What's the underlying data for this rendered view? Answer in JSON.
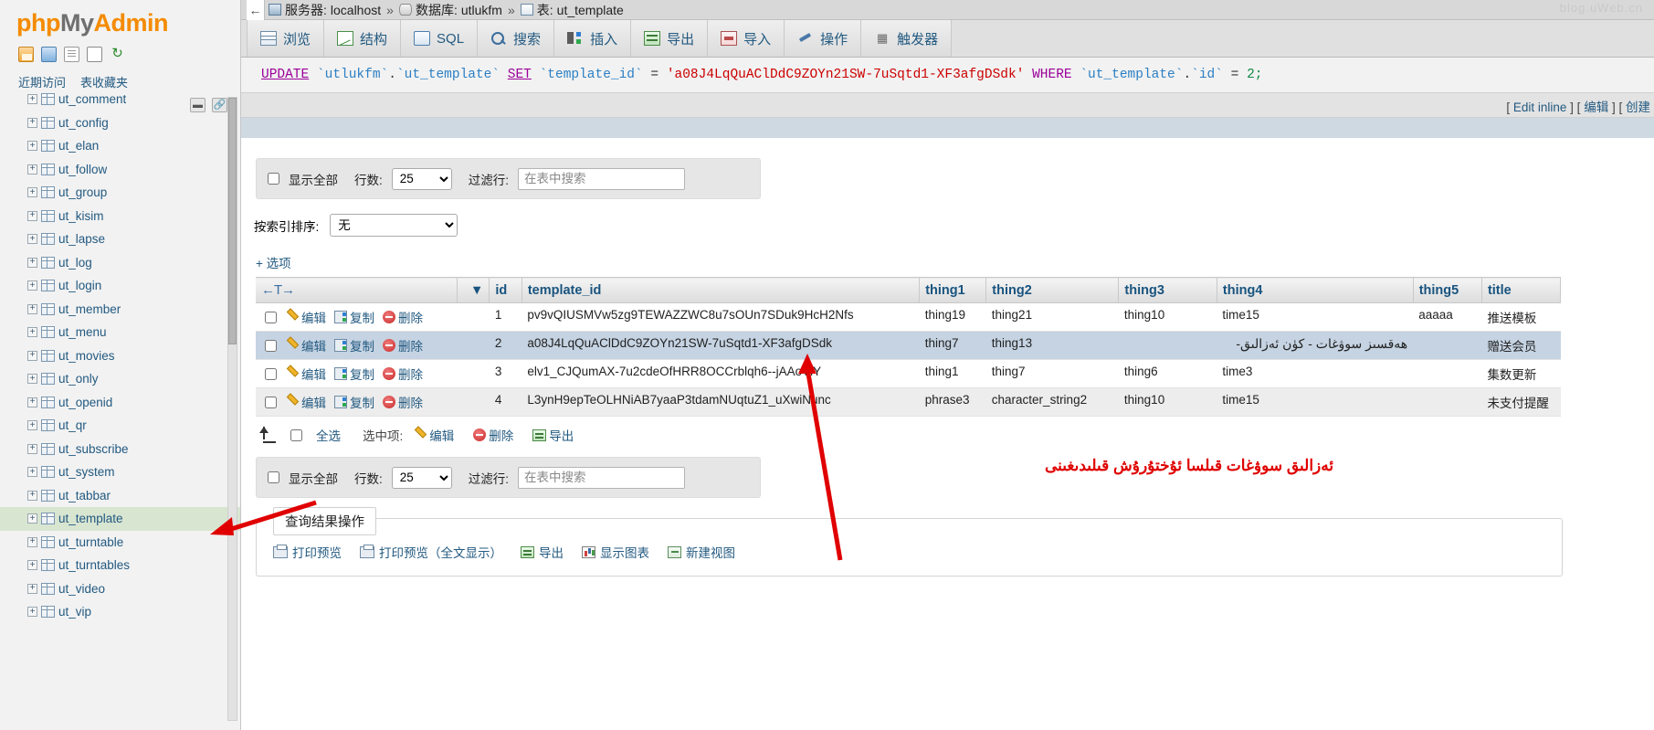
{
  "branding": {
    "logo_php": "php",
    "logo_my": "My",
    "logo_admin": "Admin"
  },
  "nav": {
    "icons": [
      "home-icon",
      "exit-icon",
      "docs-icon",
      "window-icon",
      "refresh-icon"
    ],
    "tabs": [
      {
        "label": "近期访问",
        "name": "recent-tab"
      },
      {
        "label": "表收藏夹",
        "name": "favorites-tab"
      }
    ],
    "collapse_buttons": [
      "collapse-icon",
      "link-icon"
    ],
    "tables": [
      {
        "label": "ut_comment",
        "selected": false
      },
      {
        "label": "ut_config",
        "selected": false
      },
      {
        "label": "ut_elan",
        "selected": false
      },
      {
        "label": "ut_follow",
        "selected": false
      },
      {
        "label": "ut_group",
        "selected": false
      },
      {
        "label": "ut_kisim",
        "selected": false
      },
      {
        "label": "ut_lapse",
        "selected": false
      },
      {
        "label": "ut_log",
        "selected": false
      },
      {
        "label": "ut_login",
        "selected": false
      },
      {
        "label": "ut_member",
        "selected": false
      },
      {
        "label": "ut_menu",
        "selected": false
      },
      {
        "label": "ut_movies",
        "selected": false
      },
      {
        "label": "ut_only",
        "selected": false
      },
      {
        "label": "ut_openid",
        "selected": false
      },
      {
        "label": "ut_qr",
        "selected": false
      },
      {
        "label": "ut_subscribe",
        "selected": false
      },
      {
        "label": "ut_system",
        "selected": false
      },
      {
        "label": "ut_tabbar",
        "selected": false
      },
      {
        "label": "ut_template",
        "selected": true
      },
      {
        "label": "ut_turntable",
        "selected": false
      },
      {
        "label": "ut_turntables",
        "selected": false
      },
      {
        "label": "ut_video",
        "selected": false
      },
      {
        "label": "ut_vip",
        "selected": false
      }
    ]
  },
  "breadcrumb": {
    "server_label": "服务器:",
    "server_value": "localhost",
    "db_label": "数据库:",
    "db_value": "utlukfm",
    "table_label": "表:",
    "table_value": "ut_template",
    "separator": "»",
    "watermark": "blog.uWeb.cn"
  },
  "tabs": [
    {
      "label": "浏览",
      "icon": "browse-icon"
    },
    {
      "label": "结构",
      "icon": "structure-icon"
    },
    {
      "label": "SQL",
      "icon": "sql-icon"
    },
    {
      "label": "搜索",
      "icon": "search-icon"
    },
    {
      "label": "插入",
      "icon": "insert-icon"
    },
    {
      "label": "导出",
      "icon": "export-icon"
    },
    {
      "label": "导入",
      "icon": "import-icon"
    },
    {
      "label": "操作",
      "icon": "operations-icon"
    },
    {
      "label": "触发器",
      "icon": "triggers-icon"
    }
  ],
  "sql": {
    "update": "UPDATE",
    "tick": "`",
    "db": "utlukfm",
    "dot": ".",
    "table": "ut_template",
    "set": "SET",
    "column": "template_id",
    "eq": "=",
    "quote": "'",
    "value": "a08J4LqQuAClDdC9ZOYn21SW-7uSqtd1-XF3afgDSdk",
    "where": "WHERE",
    "where_table": "ut_template",
    "where_col": "id",
    "where_eq": "=",
    "where_val": "2",
    "semicolon": ";"
  },
  "edit_links": {
    "open": "[",
    "edit_inline": "Edit inline",
    "mid1": "] [",
    "edit": "编辑",
    "mid2": "] [",
    "create": "创建",
    "full": "[ Edit inline ] [ 编辑 ] [ 创建"
  },
  "options_top": {
    "show_all_label": "显示全部",
    "rows_label": "行数:",
    "rows_value": "25",
    "filter_label": "过滤行:",
    "filter_placeholder": "在表中搜索",
    "filter_value": ""
  },
  "sort": {
    "label": "按索引排序:",
    "value": "无"
  },
  "options_link": "+ 选项",
  "table": {
    "nav_arrows": "←T→",
    "sort_caret": "▼",
    "columns": [
      "id",
      "template_id",
      "thing1",
      "thing2",
      "thing3",
      "thing4",
      "thing5",
      "title"
    ],
    "row_actions": {
      "edit": "编辑",
      "copy": "复制",
      "delete": "删除"
    },
    "rows": [
      {
        "id": "1",
        "template_id": "pv9vQIUSMVw5zg9TEWAZZWC8u7sOUn7SDuk9HcH2Nfs",
        "thing1": "thing19",
        "thing2": "thing21",
        "thing3": "thing10",
        "thing4": "time15",
        "thing5": "aaaaa",
        "title": "推送模板",
        "highlight": false,
        "wrap": false
      },
      {
        "id": "2",
        "template_id": "a08J4LqQuAClDdC9ZOYn21SW-7uSqtd1-XF3afgDSdk",
        "thing1": "thing7",
        "thing2": "thing13",
        "thing3": "",
        "thing4": "هەقسىز سوۋغات - كۈن ئەزالىق-",
        "thing5": "",
        "title": "赠送会员",
        "highlight": true,
        "wrap": true
      },
      {
        "id": "3",
        "template_id": "elv1_CJQumAX-7u2cdeOfHRR8OCCrblqh6--jAAoVlY",
        "thing1": "thing1",
        "thing2": "thing7",
        "thing3": "thing6",
        "thing4": "time3",
        "thing5": "",
        "title": "集数更新",
        "highlight": false,
        "wrap": true
      },
      {
        "id": "4",
        "template_id": "L3ynH9epTeOLHNiAB7yaaP3tdamNUqtuZ1_uXwiNunc",
        "thing1": "phrase3",
        "thing2": "character_string2",
        "thing3": "thing10",
        "thing4": "time15",
        "thing5": "",
        "title": "未支付提醒",
        "highlight": false,
        "wrap": false
      }
    ]
  },
  "bottom_actions": {
    "select_all": "全选",
    "with_selected": "选中项:",
    "edit": "编辑",
    "delete": "删除",
    "export": "导出"
  },
  "options_bottom": {
    "show_all_label": "显示全部",
    "rows_label": "行数:",
    "rows_value": "25",
    "filter_label": "过滤行:",
    "filter_placeholder": "在表中搜索",
    "filter_value": ""
  },
  "result_ops": {
    "legend": "查询结果操作",
    "links": [
      {
        "label": "打印预览",
        "icon": "print-icon"
      },
      {
        "label": "打印预览（全文显示）",
        "icon": "print-full-icon"
      },
      {
        "label": "导出",
        "icon": "export-icon"
      },
      {
        "label": "显示图表",
        "icon": "chart-icon"
      },
      {
        "label": "新建视图",
        "icon": "new-view-icon"
      }
    ]
  },
  "annotation": {
    "text": "ئەزالىق سوۋغات قىلسا ئۇختۇرۇش قىلىدىغىنى",
    "color": "#e00000"
  }
}
